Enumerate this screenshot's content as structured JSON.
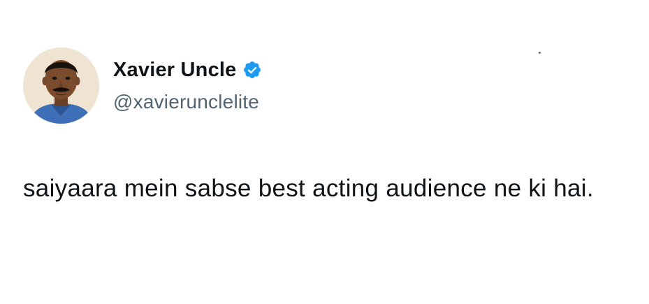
{
  "author": {
    "display_name": "Xavier Uncle",
    "handle": "@xavierunclelite",
    "verified": true,
    "avatar_icon": "person-photo-avatar"
  },
  "tweet": {
    "text": "saiyaara mein sabse best acting audience ne ki hai."
  },
  "colors": {
    "background": "#ffffff",
    "name": "#0f1419",
    "handle": "#536471",
    "verified_badge": "#1d9bf0"
  }
}
